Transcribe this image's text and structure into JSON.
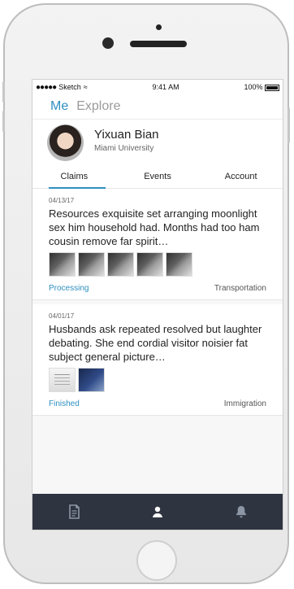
{
  "status_bar": {
    "signal": "●●●●●",
    "carrier": "Sketch",
    "wifi": "≈",
    "time": "9:41 AM",
    "battery": "100%"
  },
  "nav": {
    "active": "Me",
    "inactive": "Explore"
  },
  "profile": {
    "name": "Yixuan Bian",
    "school": "Miami University"
  },
  "tabs": [
    {
      "label": "Claims"
    },
    {
      "label": "Events"
    },
    {
      "label": "Account"
    }
  ],
  "cards": [
    {
      "date": "04/13/17",
      "description": "Resources exquisite set arranging moonlight sex him household had. Months had too ham cousin remove far spirit…",
      "status": "Processing",
      "category": "Transportation"
    },
    {
      "date": "04/01/17",
      "description": "Husbands ask repeated resolved but laughter debating. She end cordial visitor noisier fat subject general picture…",
      "status": "Finished",
      "category": "Immigration"
    }
  ],
  "bottom_nav": {
    "icons": [
      "document-icon",
      "user-icon",
      "bell-icon"
    ]
  },
  "colors": {
    "accent": "#2f8fc1",
    "bottom_bar": "#2e3440"
  }
}
